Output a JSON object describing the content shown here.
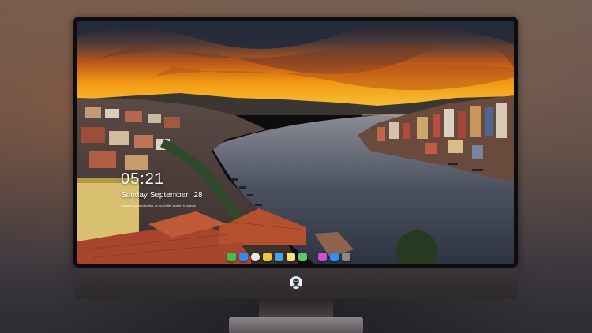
{
  "lock_screen": {
    "time": "05:21",
    "weekday": "Sunday",
    "month": "September",
    "day": "28",
    "hint": "Press the power button, or touch the screen to unlock"
  },
  "dock": {
    "apps": [
      {
        "name": "messages-app-icon",
        "color": "#3fbf4e"
      },
      {
        "name": "mail-app-icon",
        "color": "#2d8cf0"
      },
      {
        "name": "clock-app-icon",
        "color": "#e8e8e8"
      },
      {
        "name": "notes-app-icon",
        "color": "#f2c230"
      },
      {
        "name": "weather-app-icon",
        "color": "#3aa7e6"
      },
      {
        "name": "reminders-app-icon",
        "color": "#f4e57a"
      },
      {
        "name": "maps-app-icon",
        "color": "#5fc66a"
      },
      {
        "name": "music-app-icon",
        "color": "#d64bd0"
      },
      {
        "name": "app-store-icon",
        "color": "#2f8ff5"
      },
      {
        "name": "camera-app-icon",
        "color": "#8a8a8a"
      }
    ]
  }
}
